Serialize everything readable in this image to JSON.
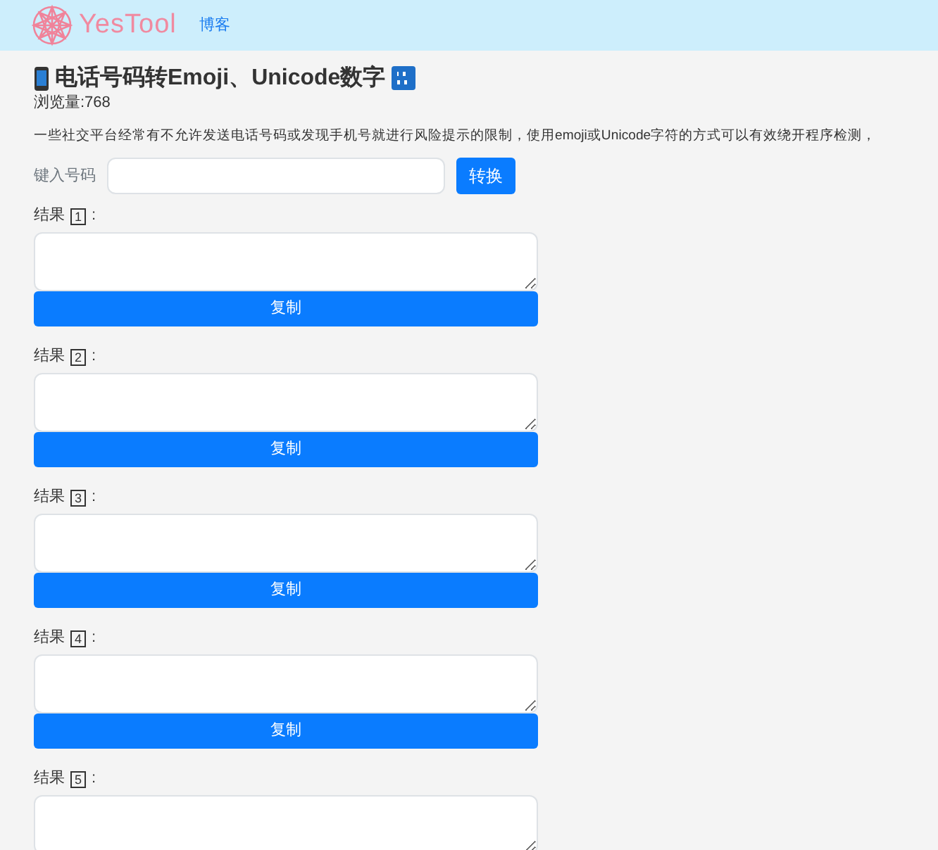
{
  "navbar": {
    "brand": "YesTool",
    "links": [
      "博客"
    ]
  },
  "title": "电话号码转Emoji、Unicode数字",
  "views": "浏览量:768",
  "description": "一些社交平台经常有不允许发送电话号码或发现手机号就进行风险提示的限制，使用emoji或Unicode字符的方式可以有效绕开程序检测，",
  "input": {
    "label": "键入号码",
    "button": "转换"
  },
  "results": [
    {
      "label": "结果",
      "number": "1",
      "colon": ":",
      "copy_button": "复制"
    },
    {
      "label": "结果",
      "number": "2",
      "colon": ":",
      "copy_button": "复制"
    },
    {
      "label": "结果",
      "number": "3",
      "colon": ":",
      "copy_button": "复制"
    },
    {
      "label": "结果",
      "number": "4",
      "colon": ":",
      "copy_button": "复制"
    },
    {
      "label": "结果",
      "number": "5",
      "colon": ":"
    }
  ]
}
